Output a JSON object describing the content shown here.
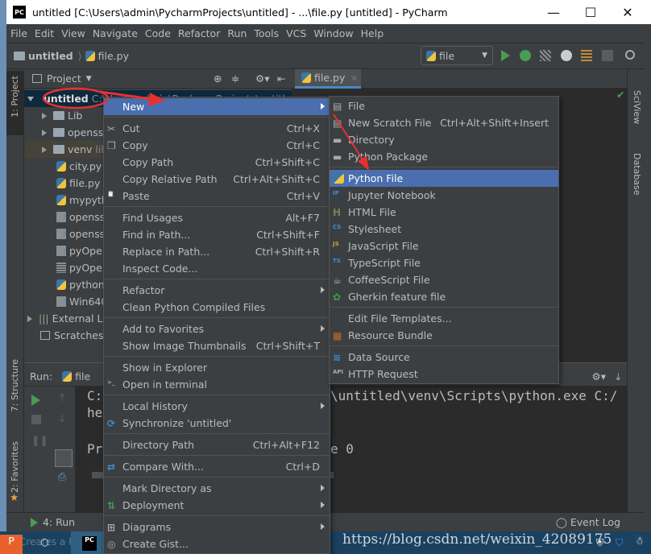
{
  "window": {
    "title": "untitled [C:\\Users\\admin\\PycharmProjects\\untitled] - ...\\file.py [untitled] - PyCharm",
    "app_icon": "PC",
    "minimize": "—",
    "maximize": "☐",
    "close": "✕"
  },
  "menubar": [
    "File",
    "Edit",
    "View",
    "Navigate",
    "Code",
    "Refactor",
    "Run",
    "Tools",
    "VCS",
    "Window",
    "Help"
  ],
  "navbar": {
    "crumbs": [
      "untitled",
      "file.py"
    ],
    "run_config": "file"
  },
  "left_strip": {
    "project": "1: Project",
    "structure": "7: Structure",
    "favorites": "2: Favorites"
  },
  "right_strip": {
    "sciview": "SciView",
    "database": "Database"
  },
  "project_panel": {
    "title": "Project",
    "tree": [
      {
        "label": "untitled",
        "extra": "C:\\Users\\admin\\PycharmProjects\\untitled",
        "type": "root"
      },
      {
        "label": "Lib",
        "type": "folder"
      },
      {
        "label": "openss",
        "type": "folder"
      },
      {
        "label": "venv",
        "extra": "lil",
        "type": "folder"
      },
      {
        "label": "city.py",
        "type": "py"
      },
      {
        "label": "file.py",
        "type": "py"
      },
      {
        "label": "mypyth",
        "type": "py"
      },
      {
        "label": "openss",
        "type": "unknown"
      },
      {
        "label": "openss",
        "type": "unknown"
      },
      {
        "label": "pyOpe",
        "type": "unknown"
      },
      {
        "label": "pyOpe",
        "type": "archive"
      },
      {
        "label": "python",
        "type": "py"
      },
      {
        "label": "Win640",
        "type": "unknown"
      },
      {
        "label": "External Li",
        "type": "lib"
      },
      {
        "label": "Scratches",
        "type": "scratch"
      }
    ]
  },
  "editor": {
    "tab": "file.py"
  },
  "run_panel": {
    "label": "Run:",
    "tab": "file",
    "console": [
      "C:",
      "\\untitled\\venv\\Scripts\\python.exe C:/",
      "he",
      "Pr",
      "e 0"
    ]
  },
  "bottombar": {
    "run": "4: Run",
    "event_log": "Event Log"
  },
  "status": {
    "hint": "Creates a Python file from the specified template",
    "watermark": "https://blog.csdn.net/weixin_42089175"
  },
  "context_menu": [
    {
      "label": "New",
      "submenu": true,
      "highlighted": true
    },
    {
      "sep": true
    },
    {
      "label": "Cut",
      "shortcut": "Ctrl+X",
      "icon": "scissors-icon"
    },
    {
      "label": "Copy",
      "shortcut": "Ctrl+C",
      "icon": "copy-icon"
    },
    {
      "label": "Copy Path",
      "shortcut": "Ctrl+Shift+C"
    },
    {
      "label": "Copy Relative Path",
      "shortcut": "Ctrl+Alt+Shift+C"
    },
    {
      "label": "Paste",
      "shortcut": "Ctrl+V",
      "icon": "paste-icon"
    },
    {
      "sep": true
    },
    {
      "label": "Find Usages",
      "shortcut": "Alt+F7"
    },
    {
      "label": "Find in Path...",
      "shortcut": "Ctrl+Shift+F"
    },
    {
      "label": "Replace in Path...",
      "shortcut": "Ctrl+Shift+R"
    },
    {
      "label": "Inspect Code..."
    },
    {
      "sep": true
    },
    {
      "label": "Refactor",
      "submenu": true
    },
    {
      "label": "Clean Python Compiled Files"
    },
    {
      "sep": true
    },
    {
      "label": "Add to Favorites",
      "submenu": true
    },
    {
      "label": "Show Image Thumbnails",
      "shortcut": "Ctrl+Shift+T"
    },
    {
      "sep": true
    },
    {
      "label": "Show in Explorer"
    },
    {
      "label": "Open in terminal",
      "icon": "terminal-icon"
    },
    {
      "sep": true
    },
    {
      "label": "Local History",
      "submenu": true
    },
    {
      "label": "Synchronize 'untitled'",
      "icon": "sync-icon"
    },
    {
      "sep": true
    },
    {
      "label": "Directory Path",
      "shortcut": "Ctrl+Alt+F12"
    },
    {
      "sep": true
    },
    {
      "label": "Compare With...",
      "shortcut": "Ctrl+D",
      "icon": "compare-icon"
    },
    {
      "sep": true
    },
    {
      "label": "Mark Directory as",
      "submenu": true
    },
    {
      "label": "Deployment",
      "submenu": true,
      "icon": "deployment-icon"
    },
    {
      "sep": true
    },
    {
      "label": "Diagrams",
      "submenu": true,
      "icon": "diagram-icon"
    },
    {
      "label": "Create Gist...",
      "icon": "github-icon"
    }
  ],
  "new_submenu": [
    {
      "label": "File",
      "icon": "file-icon"
    },
    {
      "label": "New Scratch File",
      "shortcut": "Ctrl+Alt+Shift+Insert",
      "icon": "scratch-icon"
    },
    {
      "label": "Directory",
      "icon": "folder-icon"
    },
    {
      "label": "Python Package",
      "icon": "package-icon"
    },
    {
      "sep": true
    },
    {
      "label": "Python File",
      "highlighted": true,
      "icon": "python-file-icon"
    },
    {
      "label": "Jupyter Notebook",
      "icon": "jupyter-icon"
    },
    {
      "label": "HTML File",
      "icon": "html-icon"
    },
    {
      "label": "Stylesheet",
      "icon": "css-icon"
    },
    {
      "label": "JavaScript File",
      "icon": "js-icon"
    },
    {
      "label": "TypeScript File",
      "icon": "ts-icon"
    },
    {
      "label": "CoffeeScript File",
      "icon": "coffeescript-icon"
    },
    {
      "label": "Gherkin feature file",
      "icon": "gherkin-icon"
    },
    {
      "sep": true
    },
    {
      "label": "Edit File Templates..."
    },
    {
      "label": "Resource Bundle",
      "icon": "resource-bundle-icon"
    },
    {
      "sep": true
    },
    {
      "label": "Data Source",
      "icon": "database-icon"
    },
    {
      "label": "HTTP Request",
      "icon": "api-icon"
    }
  ],
  "colors": {
    "highlight": "#4b6eaf",
    "annotation": "#e8312f",
    "run_green": "#499c54"
  }
}
